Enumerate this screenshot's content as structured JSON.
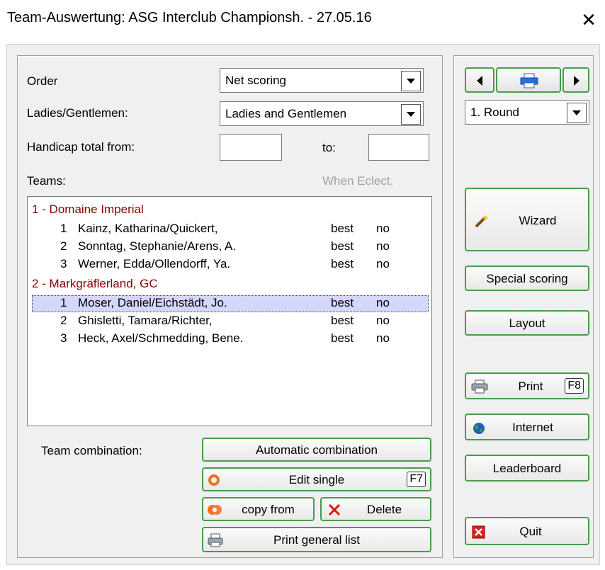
{
  "window": {
    "title": "Team-Auswertung: ASG Interclub Championsh. - 27.05.16",
    "close_glyph": "✕"
  },
  "filters": {
    "order_label": "Order",
    "order_value": "Net scoring",
    "gender_label": "Ladies/Gentlemen:",
    "gender_value": "Ladies and Gentlemen",
    "handicap_label": "Handicap total from:",
    "handicap_from": "",
    "to_label": "to:",
    "handicap_to": ""
  },
  "teams": {
    "label": "Teams:",
    "hint": "When Eclect.",
    "groups": [
      {
        "name": "1 - Domaine Imperial",
        "rows": [
          {
            "num": "1",
            "name": "Kainz, Katharina/Quickert,",
            "when": "best",
            "eclect": "no"
          },
          {
            "num": "2",
            "name": "Sonntag, Stephanie/Arens, A.",
            "when": "best",
            "eclect": "no"
          },
          {
            "num": "3",
            "name": "Werner, Edda/Ollendorff, Ya.",
            "when": "best",
            "eclect": "no"
          }
        ]
      },
      {
        "name": "2 - Markgräflerland, GC",
        "rows": [
          {
            "num": "1",
            "name": "Moser, Daniel/Eichstädt, Jo.",
            "when": "best",
            "eclect": "no"
          },
          {
            "num": "2",
            "name": "Ghisletti, Tamara/Richter,",
            "when": "best",
            "eclect": "no"
          },
          {
            "num": "3",
            "name": "Heck, Axel/Schmedding, Bene.",
            "when": "best",
            "eclect": "no"
          }
        ]
      }
    ]
  },
  "combination": {
    "label": "Team combination:",
    "automatic": "Automatic combination",
    "edit_single": "Edit single",
    "edit_key": "F7",
    "copy_from": "copy from",
    "delete": "Delete",
    "print_general": "Print general list"
  },
  "side": {
    "round_value": "1. Round",
    "wizard": "Wizard",
    "special_scoring": "Special scoring",
    "layout": "Layout",
    "print": "Print",
    "print_key": "F8",
    "internet": "Internet",
    "leaderboard": "Leaderboard",
    "quit": "Quit"
  },
  "icons": {
    "prev": "left-arrow-icon",
    "next": "right-arrow-icon",
    "printer_nav": "printer-icon",
    "wand": "magic-wand-icon",
    "printer": "printer-icon",
    "globe": "globe-icon",
    "quit": "quit-icon",
    "edit": "target-icon",
    "copy": "copy-icon",
    "delete": "delete-icon"
  },
  "colors": {
    "team_header": "#8b0000",
    "button_border": "#4c9a4c",
    "selection": "#d6d6fb"
  }
}
